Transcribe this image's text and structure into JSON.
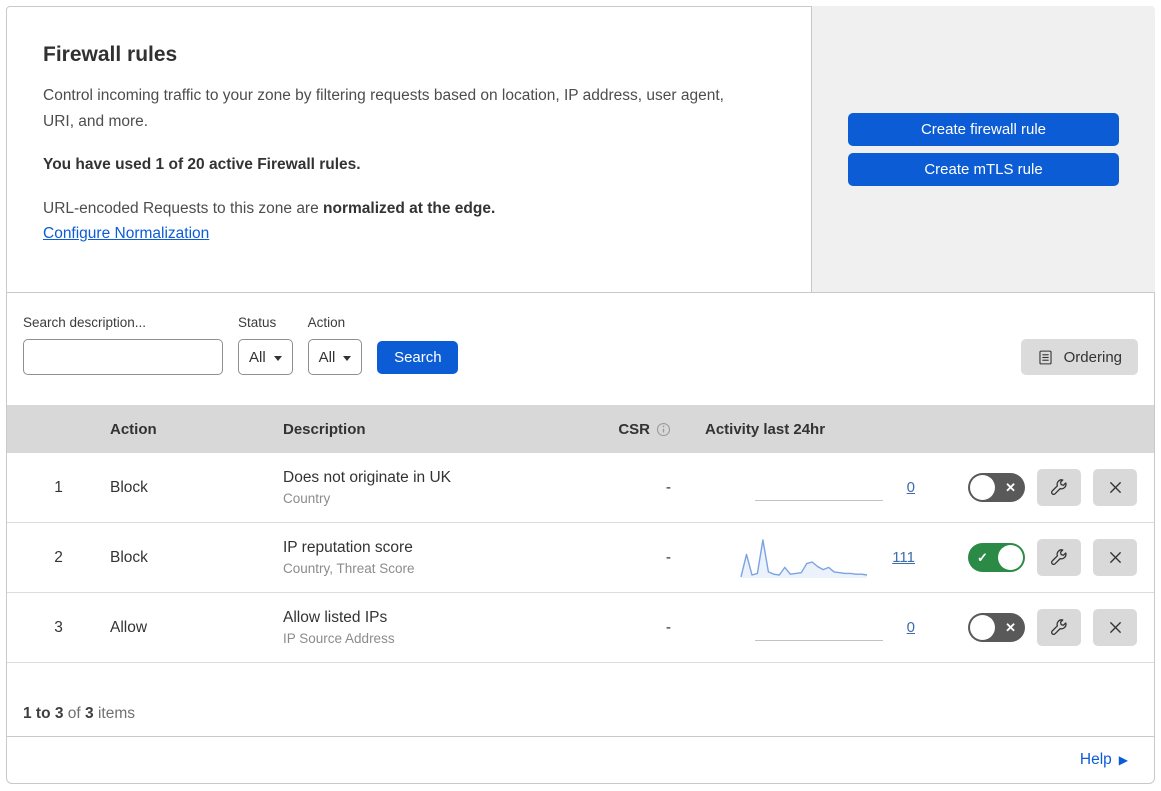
{
  "intro": {
    "title": "Firewall rules",
    "description": "Control incoming traffic to your zone by filtering requests based on location, IP address, user agent, URI, and more.",
    "usage": "You have used 1 of 20 active Firewall rules.",
    "normalization_prefix": "URL-encoded Requests to this zone are ",
    "normalization_bold": "normalized at the edge.",
    "normalization_link": "Configure Normalization",
    "buttons": {
      "create_firewall": "Create firewall rule",
      "create_mtls": "Create mTLS rule"
    }
  },
  "filters": {
    "search_label": "Search description...",
    "search_value": "",
    "status_label": "Status",
    "status_value": "All",
    "action_label": "Action",
    "action_value": "All",
    "search_button": "Search",
    "ordering_button": "Ordering"
  },
  "table": {
    "columns": {
      "action": "Action",
      "description": "Description",
      "csr": "CSR",
      "activity": "Activity last 24hr"
    },
    "rows": [
      {
        "priority": "1",
        "action": "Block",
        "description": "Does not originate in UK",
        "fields": "Country",
        "csr": "-",
        "activity_count": "0",
        "enabled": false
      },
      {
        "priority": "2",
        "action": "Block",
        "description": "IP reputation score",
        "fields": "Country, Threat Score",
        "csr": "-",
        "activity_count": "111",
        "enabled": true,
        "activity_sparkline": [
          3,
          62,
          8,
          12,
          100,
          16,
          10,
          8,
          28,
          10,
          12,
          14,
          38,
          42,
          30,
          22,
          28,
          16,
          14,
          12,
          12,
          10,
          10,
          8
        ]
      },
      {
        "priority": "3",
        "action": "Allow",
        "description": "Allow listed IPs",
        "fields": "IP Source Address",
        "csr": "-",
        "activity_count": "0",
        "enabled": false
      }
    ]
  },
  "footer": {
    "range": "1 to 3",
    "of": "of",
    "total": "3",
    "items": "items",
    "help": "Help"
  },
  "icons": {
    "search": "⌕",
    "caret_down": "▾",
    "ordering": "▤",
    "info": "ⓘ",
    "check": "✓",
    "x": "✕",
    "wrench": "wrench",
    "close": "✕",
    "chevron_right": "▶"
  },
  "colors": {
    "accent_blue": "#0b5cd5",
    "toggle_on_green": "#2c8a47",
    "toggle_off_gray": "#595959",
    "sparkline_blue": "#7aa3e3",
    "panel_gray": "#f0f0f0",
    "table_header_gray": "#d8d8d8"
  }
}
